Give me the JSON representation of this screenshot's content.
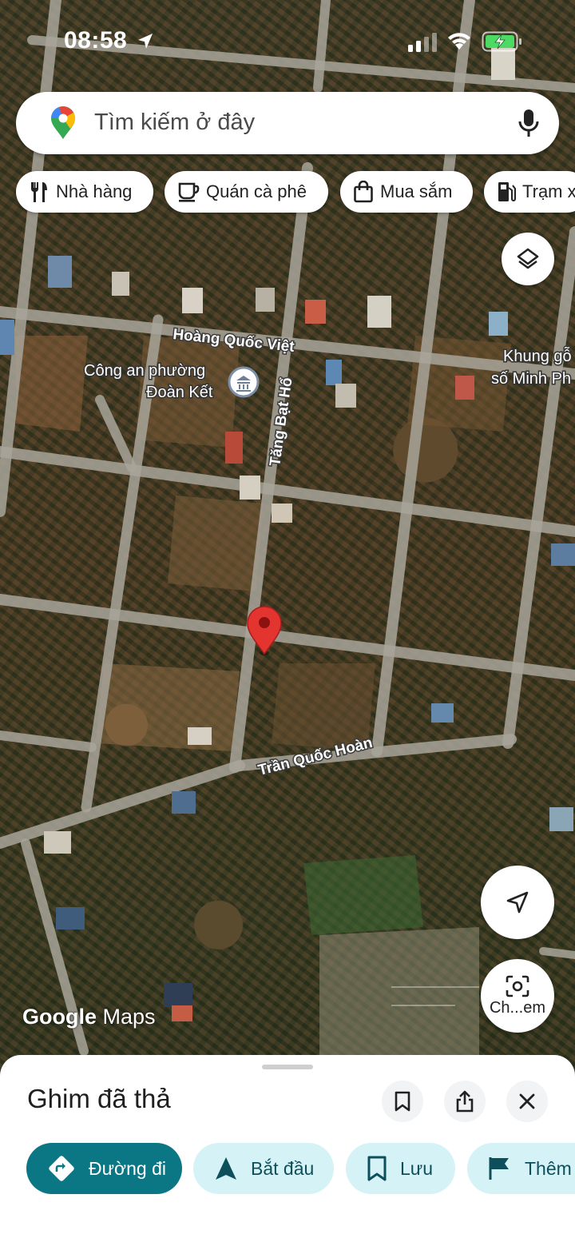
{
  "status_bar": {
    "time": "08:58"
  },
  "search": {
    "placeholder": "Tìm kiếm ở đây"
  },
  "chips": [
    {
      "label": "Nhà hàng",
      "icon": "fork-knife-icon"
    },
    {
      "label": "Quán cà phê",
      "icon": "coffee-cup-icon"
    },
    {
      "label": "Mua sắm",
      "icon": "shopping-bag-icon"
    },
    {
      "label": "Trạm x",
      "icon": "gas-station-icon"
    }
  ],
  "map": {
    "roads": [
      "Hoàng Quốc Việt",
      "Tăng Bạt Hổ",
      "Trần Quốc Hoàn"
    ],
    "pois": [
      {
        "line1": "Công an phường",
        "line2": "Đoàn Kết",
        "icon": "government-building-icon"
      },
      {
        "line1": "Khung gỗ",
        "line2": "số Minh Ph"
      }
    ],
    "watermark": {
      "brand": "Google",
      "product": "Maps"
    }
  },
  "fabs": {
    "layers_icon": "layers-icon",
    "location_icon": "navigation-arrow-icon",
    "lens_label": "Ch...em"
  },
  "sheet": {
    "title": "Ghim đã thả",
    "actions": [
      {
        "label": "Đường đi",
        "icon": "directions-icon"
      },
      {
        "label": "Bắt đầu",
        "icon": "navigation-start-icon"
      },
      {
        "label": "Lưu",
        "icon": "bookmark-icon"
      },
      {
        "label": "Thêm",
        "icon": "flag-icon"
      }
    ]
  },
  "colors": {
    "accent": "#0b7785",
    "action_light": "#d5f2f6",
    "pin": "#e3342f"
  }
}
